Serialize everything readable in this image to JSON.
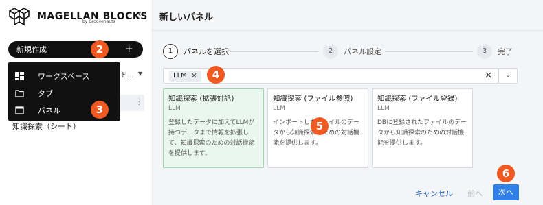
{
  "app": {
    "logo_text": "MAGELLAN BLOCKS",
    "logo_sub": "by Groovenauts",
    "collapse_glyph": "‹"
  },
  "sidebar": {
    "new_button_label": "新規作成",
    "new_button_plus": "+",
    "select_stub": "ト...",
    "item_text": "知識探索（シート）",
    "dropdown": [
      {
        "label": "ワークスペース",
        "icon": "grid-icon"
      },
      {
        "label": "タブ",
        "icon": "folder-icon"
      },
      {
        "label": "パネル",
        "icon": "window-icon"
      }
    ]
  },
  "main": {
    "title": "新しいパネル",
    "steps": [
      {
        "num": "1",
        "label": "パネルを選択",
        "active": true
      },
      {
        "num": "2",
        "label": "パネル設定",
        "active": false
      },
      {
        "num": "3",
        "label": "完了",
        "active": false
      }
    ],
    "filter_chip": "LLM",
    "cards": [
      {
        "title": "知識探索 (拡張対話)",
        "tag": "LLM",
        "desc": "登録したデータに加えてLLMが持つデータまで情報を拡張して、知識探索のための対話機能を提供します。",
        "selected": true
      },
      {
        "title": "知識探索 (ファイル参照)",
        "tag": "LLM",
        "desc": "インポートしたファイルのデータから知識探索のための対話機能を提供します。",
        "selected": false
      },
      {
        "title": "知識探索 (ファイル登録)",
        "tag": "LLM",
        "desc": "DBに登録されたファイルのデータから知識探索のための対話機能を提供します。",
        "selected": false
      }
    ],
    "footer": {
      "cancel": "キャンセル",
      "prev": "前へ",
      "next": "次へ"
    }
  },
  "callouts": [
    "2",
    "3",
    "4",
    "5",
    "6"
  ],
  "colors": {
    "accent": "#2f80e7",
    "callout": "#f05a22",
    "selected_card": "#eaf7ee"
  }
}
